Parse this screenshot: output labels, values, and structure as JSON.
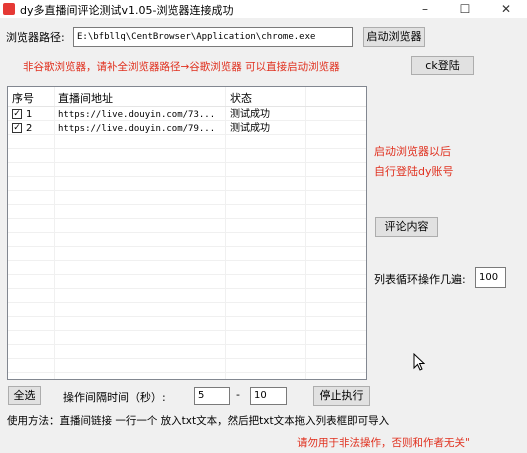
{
  "window": {
    "title": "dy多直播间评论测试v1.05-浏览器连接成功",
    "minimize": "–",
    "maximize": "☐",
    "close": "✕"
  },
  "browser": {
    "label": "浏览器路径:",
    "path": "E:\\bfbllq\\CentBrowser\\Application\\chrome.exe",
    "launch_button": "启动浏览器",
    "hint": "非谷歌浏览器，请补全浏览器路径→谷歌浏览器 可以直接启动浏览器",
    "ck_login_button": "ck登陆"
  },
  "table": {
    "columns": [
      "序号",
      "直播间地址",
      "状态"
    ],
    "rows": [
      {
        "index": "1",
        "url": "https://live.douyin.com/73...",
        "status": "测试成功",
        "checked": true
      },
      {
        "index": "2",
        "url": "https://live.douyin.com/79...",
        "status": "测试成功",
        "checked": true
      }
    ]
  },
  "side": {
    "note_line1": "启动浏览器以后",
    "note_line2": "自行登陆dy账号",
    "comment_button": "评论内容",
    "loop_label": "列表循环操作几遍:",
    "loop_value": "100"
  },
  "bottom": {
    "select_all": "全选",
    "interval_label": "操作间隔时间（秒）:",
    "interval_min": "5",
    "dash": "-",
    "interval_max": "10",
    "stop_button": "停止执行",
    "usage": "使用方法：直播间链接 一行一个 放入txt文本，然后把txt文本拖入列表框即可导入",
    "warning": "请勿用于非法操作，否则和作者无关\""
  },
  "colors": {
    "accent_red": "#e0301e",
    "app_icon": "#e53935"
  }
}
